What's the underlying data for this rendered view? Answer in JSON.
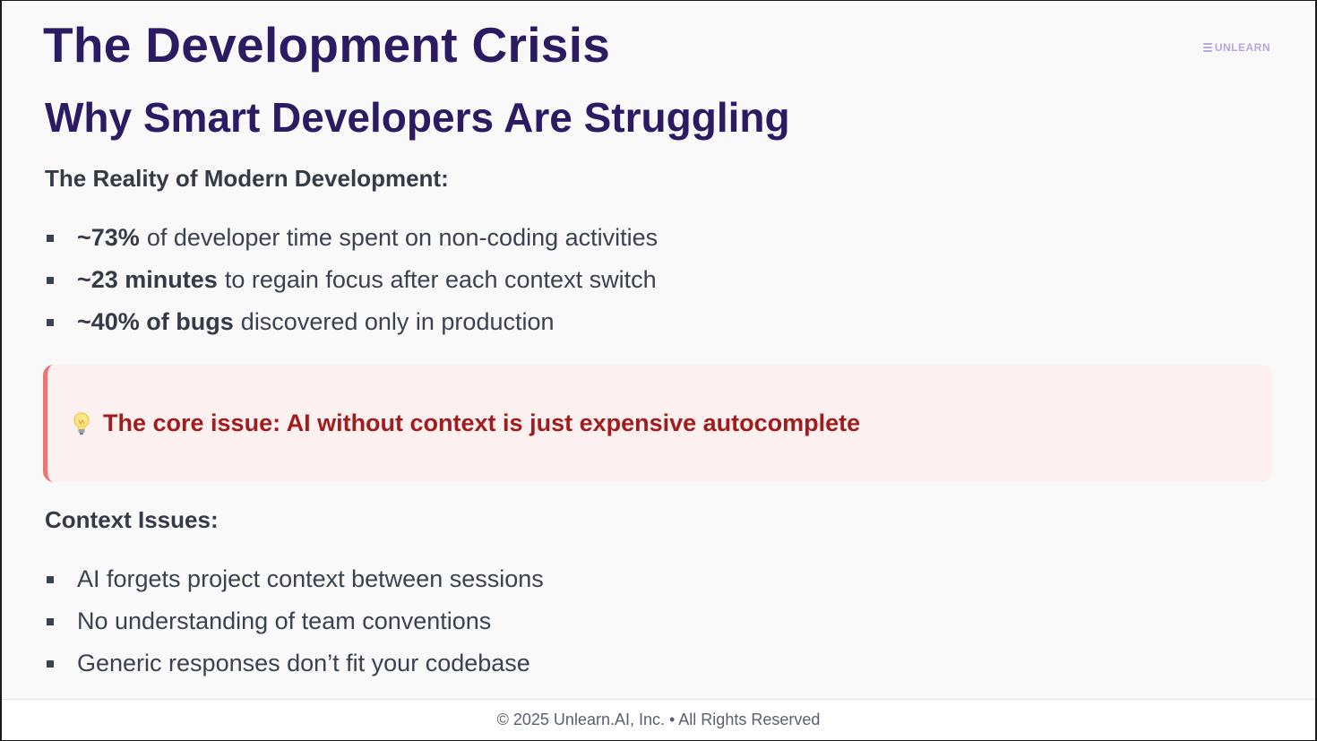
{
  "slide": {
    "title": "The Development Crisis",
    "subtitle": "Why Smart Developers Are Struggling",
    "logo_text": "UNLEARN"
  },
  "reality": {
    "heading": "The Reality of Modern Development:",
    "items": [
      {
        "bold": "~73%",
        "text": "of developer time spent on non-coding activities"
      },
      {
        "bold": "~23 minutes",
        "text": "to regain focus after each context switch"
      },
      {
        "bold": "~40% of bugs",
        "text": "discovered only in production"
      }
    ]
  },
  "callout": {
    "icon": "lightbulb-icon",
    "text": "The core issue: AI without context is just expensive autocomplete",
    "accent_color": "#ee7474",
    "text_color": "#a11c1c"
  },
  "context": {
    "heading": "Context Issues:",
    "items": [
      "AI forgets project context between sessions",
      "No understanding of team conventions",
      "Generic responses don’t fit your codebase"
    ]
  },
  "footer": {
    "text": "© 2025 Unlearn.AI, Inc. • All Rights Reserved"
  },
  "colors": {
    "title": "#2b1b62",
    "body_text": "#3a4150",
    "background": "#f9f9f9"
  }
}
